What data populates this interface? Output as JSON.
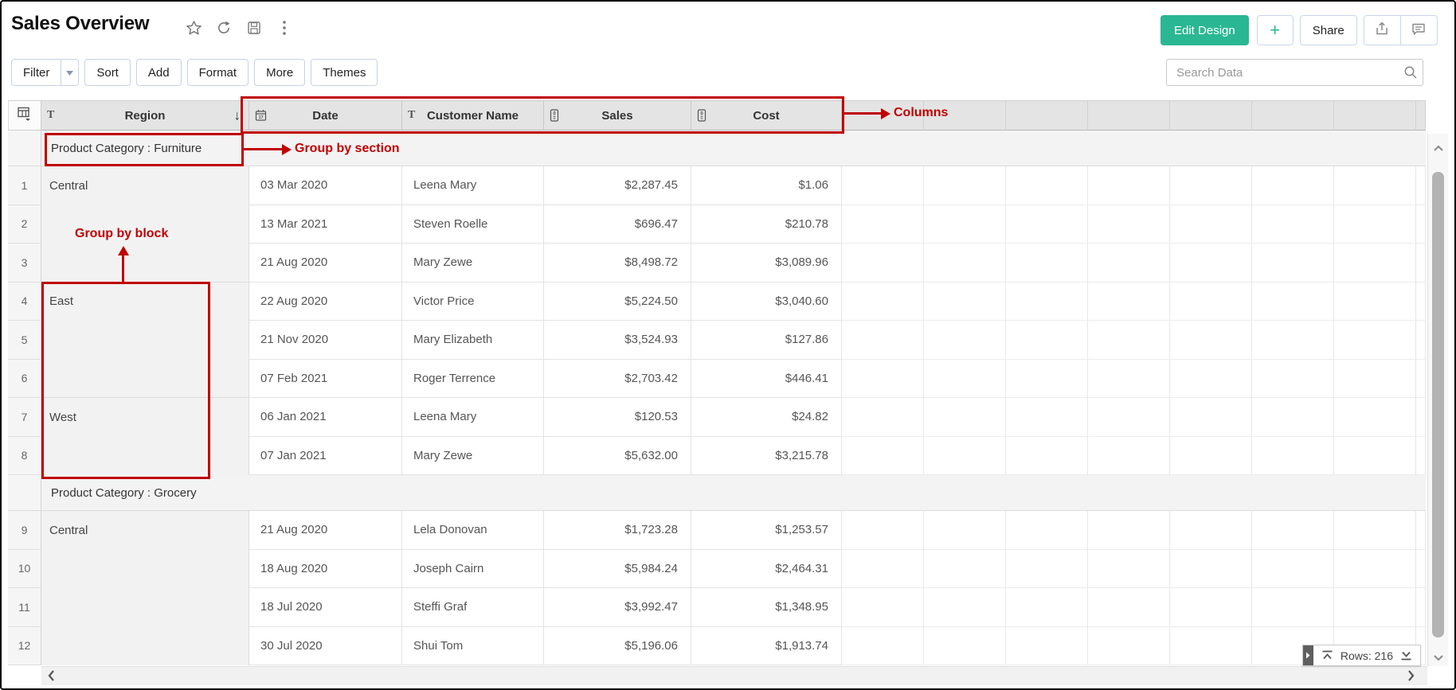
{
  "page": {
    "title": "Sales Overview"
  },
  "topbar": {
    "edit_design": "Edit Design",
    "plus": "+",
    "share": "Share"
  },
  "toolbar": {
    "filter": "Filter",
    "sort": "Sort",
    "add": "Add",
    "format": "Format",
    "more": "More",
    "themes": "Themes",
    "search_placeholder": "Search Data"
  },
  "annotations": {
    "columns": "Columns",
    "group_by_section": "Group by section",
    "group_by_block": "Group by block",
    "color": "#c00000"
  },
  "table": {
    "columns": [
      {
        "label": "Region",
        "type": "text",
        "sort": "desc"
      },
      {
        "label": "Date",
        "type": "date"
      },
      {
        "label": "Customer Name",
        "type": "text"
      },
      {
        "label": "Sales",
        "type": "number"
      },
      {
        "label": "Cost",
        "type": "number"
      }
    ],
    "sections": [
      {
        "label": "Product Category : Furniture",
        "rows": [
          {
            "num": "1",
            "region": "Central",
            "date": "03 Mar 2020",
            "customer": "Leena Mary",
            "sales": "$2,287.45",
            "cost": "$1.06"
          },
          {
            "num": "2",
            "date": "13 Mar 2021",
            "customer": "Steven Roelle",
            "sales": "$696.47",
            "cost": "$210.78"
          },
          {
            "num": "3",
            "date": "21 Aug 2020",
            "customer": "Mary Zewe",
            "sales": "$8,498.72",
            "cost": "$3,089.96",
            "block_end": true
          },
          {
            "num": "4",
            "region": "East",
            "date": "22 Aug 2020",
            "customer": "Victor Price",
            "sales": "$5,224.50",
            "cost": "$3,040.60"
          },
          {
            "num": "5",
            "date": "21 Nov 2020",
            "customer": "Mary Elizabeth",
            "sales": "$3,524.93",
            "cost": "$127.86"
          },
          {
            "num": "6",
            "date": "07 Feb 2021",
            "customer": "Roger Terrence",
            "sales": "$2,703.42",
            "cost": "$446.41",
            "block_end": true
          },
          {
            "num": "7",
            "region": "West",
            "date": "06 Jan 2021",
            "customer": "Leena Mary",
            "sales": "$120.53",
            "cost": "$24.82"
          },
          {
            "num": "8",
            "date": "07 Jan 2021",
            "customer": "Mary Zewe",
            "sales": "$5,632.00",
            "cost": "$3,215.78"
          }
        ]
      },
      {
        "label": "Product Category : Grocery",
        "rows": [
          {
            "num": "9",
            "region": "Central",
            "date": "21 Aug 2020",
            "customer": "Lela Donovan",
            "sales": "$1,723.28",
            "cost": "$1,253.57"
          },
          {
            "num": "10",
            "date": "18 Aug 2020",
            "customer": "Joseph Cairn",
            "sales": "$5,984.24",
            "cost": "$2,464.31"
          },
          {
            "num": "11",
            "date": "18 Jul 2020",
            "customer": "Steffi Graf",
            "sales": "$3,992.47",
            "cost": "$1,348.95"
          },
          {
            "num": "12",
            "date": "30 Jul 2020",
            "customer": "Shui Tom",
            "sales": "$5,196.06",
            "cost": "$1,913.74"
          }
        ]
      }
    ]
  },
  "status": {
    "rows": "Rows: 216"
  },
  "colors": {
    "accent_green": "#2ab793",
    "annotation_red": "#c00000",
    "header_bg": "#e4e4e4"
  }
}
